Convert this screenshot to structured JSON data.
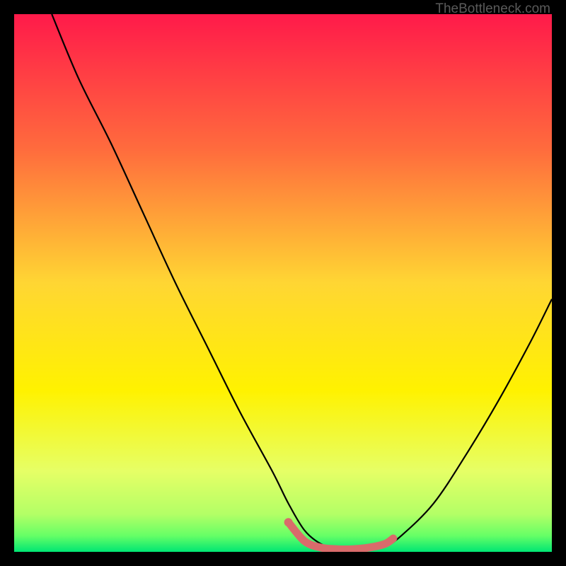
{
  "watermark": "TheBottleneck.com",
  "chart_data": {
    "type": "line",
    "title": "",
    "xlabel": "",
    "ylabel": "",
    "xlim": [
      0,
      100
    ],
    "ylim": [
      0,
      100
    ],
    "gradient_stops": [
      {
        "offset": 0,
        "color": "#ff1a4a"
      },
      {
        "offset": 25,
        "color": "#ff6b3d"
      },
      {
        "offset": 50,
        "color": "#ffd633"
      },
      {
        "offset": 70,
        "color": "#fff200"
      },
      {
        "offset": 85,
        "color": "#e6ff66"
      },
      {
        "offset": 93,
        "color": "#b3ff66"
      },
      {
        "offset": 97,
        "color": "#66ff66"
      },
      {
        "offset": 100,
        "color": "#00e673"
      }
    ],
    "series": [
      {
        "name": "bottleneck-curve",
        "color": "#000000",
        "x": [
          7,
          12,
          18,
          24,
          30,
          36,
          42,
          48,
          51,
          54,
          57,
          60,
          63,
          66,
          69,
          72,
          78,
          84,
          90,
          96,
          100
        ],
        "y": [
          100,
          88,
          76,
          63,
          50,
          38,
          26,
          15,
          9,
          4,
          1.5,
          0.5,
          0.5,
          0.5,
          1,
          3,
          9,
          18,
          28,
          39,
          47
        ]
      },
      {
        "name": "optimal-range-highlight",
        "color": "#d96b6b",
        "x": [
          51,
          54,
          57,
          60,
          63,
          66,
          69,
          70.5
        ],
        "y": [
          5.5,
          2,
          0.8,
          0.5,
          0.5,
          0.8,
          1.5,
          2.5
        ]
      }
    ]
  }
}
